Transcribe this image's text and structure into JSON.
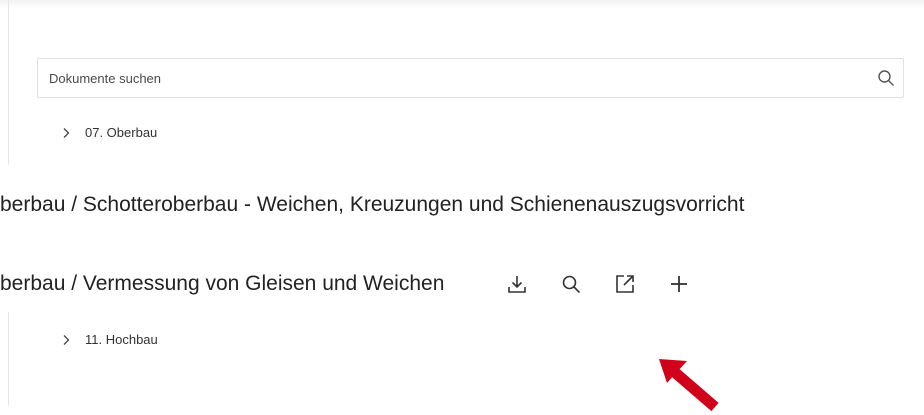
{
  "search": {
    "placeholder": "Dokumente suchen",
    "value": ""
  },
  "tree": [
    {
      "label": "07. Oberbau"
    },
    {
      "label": "11. Hochbau"
    }
  ],
  "documents": [
    {
      "title": "berbau / Schotteroberbau - Weichen, Kreuzungen und Schienenauszugsvorricht"
    },
    {
      "title": "berbau / Vermessung von Gleisen und Weichen"
    }
  ],
  "actions": [
    {
      "icon": "download-icon"
    },
    {
      "icon": "search-icon"
    },
    {
      "icon": "open-external-icon"
    },
    {
      "icon": "plus-icon"
    }
  ],
  "annotation": {
    "color": "#d0021b"
  }
}
